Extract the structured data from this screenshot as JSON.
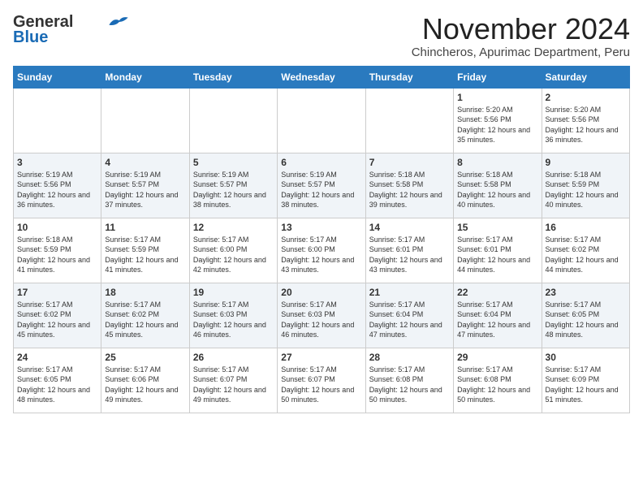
{
  "logo": {
    "line1": "General",
    "line2": "Blue"
  },
  "title": "November 2024",
  "subtitle": "Chincheros, Apurimac Department, Peru",
  "weekdays": [
    "Sunday",
    "Monday",
    "Tuesday",
    "Wednesday",
    "Thursday",
    "Friday",
    "Saturday"
  ],
  "rows": [
    [
      {
        "day": "",
        "sunrise": "",
        "sunset": "",
        "daylight": ""
      },
      {
        "day": "",
        "sunrise": "",
        "sunset": "",
        "daylight": ""
      },
      {
        "day": "",
        "sunrise": "",
        "sunset": "",
        "daylight": ""
      },
      {
        "day": "",
        "sunrise": "",
        "sunset": "",
        "daylight": ""
      },
      {
        "day": "",
        "sunrise": "",
        "sunset": "",
        "daylight": ""
      },
      {
        "day": "1",
        "sunrise": "Sunrise: 5:20 AM",
        "sunset": "Sunset: 5:56 PM",
        "daylight": "Daylight: 12 hours and 35 minutes."
      },
      {
        "day": "2",
        "sunrise": "Sunrise: 5:20 AM",
        "sunset": "Sunset: 5:56 PM",
        "daylight": "Daylight: 12 hours and 36 minutes."
      }
    ],
    [
      {
        "day": "3",
        "sunrise": "Sunrise: 5:19 AM",
        "sunset": "Sunset: 5:56 PM",
        "daylight": "Daylight: 12 hours and 36 minutes."
      },
      {
        "day": "4",
        "sunrise": "Sunrise: 5:19 AM",
        "sunset": "Sunset: 5:57 PM",
        "daylight": "Daylight: 12 hours and 37 minutes."
      },
      {
        "day": "5",
        "sunrise": "Sunrise: 5:19 AM",
        "sunset": "Sunset: 5:57 PM",
        "daylight": "Daylight: 12 hours and 38 minutes."
      },
      {
        "day": "6",
        "sunrise": "Sunrise: 5:19 AM",
        "sunset": "Sunset: 5:57 PM",
        "daylight": "Daylight: 12 hours and 38 minutes."
      },
      {
        "day": "7",
        "sunrise": "Sunrise: 5:18 AM",
        "sunset": "Sunset: 5:58 PM",
        "daylight": "Daylight: 12 hours and 39 minutes."
      },
      {
        "day": "8",
        "sunrise": "Sunrise: 5:18 AM",
        "sunset": "Sunset: 5:58 PM",
        "daylight": "Daylight: 12 hours and 40 minutes."
      },
      {
        "day": "9",
        "sunrise": "Sunrise: 5:18 AM",
        "sunset": "Sunset: 5:59 PM",
        "daylight": "Daylight: 12 hours and 40 minutes."
      }
    ],
    [
      {
        "day": "10",
        "sunrise": "Sunrise: 5:18 AM",
        "sunset": "Sunset: 5:59 PM",
        "daylight": "Daylight: 12 hours and 41 minutes."
      },
      {
        "day": "11",
        "sunrise": "Sunrise: 5:17 AM",
        "sunset": "Sunset: 5:59 PM",
        "daylight": "Daylight: 12 hours and 41 minutes."
      },
      {
        "day": "12",
        "sunrise": "Sunrise: 5:17 AM",
        "sunset": "Sunset: 6:00 PM",
        "daylight": "Daylight: 12 hours and 42 minutes."
      },
      {
        "day": "13",
        "sunrise": "Sunrise: 5:17 AM",
        "sunset": "Sunset: 6:00 PM",
        "daylight": "Daylight: 12 hours and 43 minutes."
      },
      {
        "day": "14",
        "sunrise": "Sunrise: 5:17 AM",
        "sunset": "Sunset: 6:01 PM",
        "daylight": "Daylight: 12 hours and 43 minutes."
      },
      {
        "day": "15",
        "sunrise": "Sunrise: 5:17 AM",
        "sunset": "Sunset: 6:01 PM",
        "daylight": "Daylight: 12 hours and 44 minutes."
      },
      {
        "day": "16",
        "sunrise": "Sunrise: 5:17 AM",
        "sunset": "Sunset: 6:02 PM",
        "daylight": "Daylight: 12 hours and 44 minutes."
      }
    ],
    [
      {
        "day": "17",
        "sunrise": "Sunrise: 5:17 AM",
        "sunset": "Sunset: 6:02 PM",
        "daylight": "Daylight: 12 hours and 45 minutes."
      },
      {
        "day": "18",
        "sunrise": "Sunrise: 5:17 AM",
        "sunset": "Sunset: 6:02 PM",
        "daylight": "Daylight: 12 hours and 45 minutes."
      },
      {
        "day": "19",
        "sunrise": "Sunrise: 5:17 AM",
        "sunset": "Sunset: 6:03 PM",
        "daylight": "Daylight: 12 hours and 46 minutes."
      },
      {
        "day": "20",
        "sunrise": "Sunrise: 5:17 AM",
        "sunset": "Sunset: 6:03 PM",
        "daylight": "Daylight: 12 hours and 46 minutes."
      },
      {
        "day": "21",
        "sunrise": "Sunrise: 5:17 AM",
        "sunset": "Sunset: 6:04 PM",
        "daylight": "Daylight: 12 hours and 47 minutes."
      },
      {
        "day": "22",
        "sunrise": "Sunrise: 5:17 AM",
        "sunset": "Sunset: 6:04 PM",
        "daylight": "Daylight: 12 hours and 47 minutes."
      },
      {
        "day": "23",
        "sunrise": "Sunrise: 5:17 AM",
        "sunset": "Sunset: 6:05 PM",
        "daylight": "Daylight: 12 hours and 48 minutes."
      }
    ],
    [
      {
        "day": "24",
        "sunrise": "Sunrise: 5:17 AM",
        "sunset": "Sunset: 6:05 PM",
        "daylight": "Daylight: 12 hours and 48 minutes."
      },
      {
        "day": "25",
        "sunrise": "Sunrise: 5:17 AM",
        "sunset": "Sunset: 6:06 PM",
        "daylight": "Daylight: 12 hours and 49 minutes."
      },
      {
        "day": "26",
        "sunrise": "Sunrise: 5:17 AM",
        "sunset": "Sunset: 6:07 PM",
        "daylight": "Daylight: 12 hours and 49 minutes."
      },
      {
        "day": "27",
        "sunrise": "Sunrise: 5:17 AM",
        "sunset": "Sunset: 6:07 PM",
        "daylight": "Daylight: 12 hours and 50 minutes."
      },
      {
        "day": "28",
        "sunrise": "Sunrise: 5:17 AM",
        "sunset": "Sunset: 6:08 PM",
        "daylight": "Daylight: 12 hours and 50 minutes."
      },
      {
        "day": "29",
        "sunrise": "Sunrise: 5:17 AM",
        "sunset": "Sunset: 6:08 PM",
        "daylight": "Daylight: 12 hours and 50 minutes."
      },
      {
        "day": "30",
        "sunrise": "Sunrise: 5:17 AM",
        "sunset": "Sunset: 6:09 PM",
        "daylight": "Daylight: 12 hours and 51 minutes."
      }
    ]
  ]
}
